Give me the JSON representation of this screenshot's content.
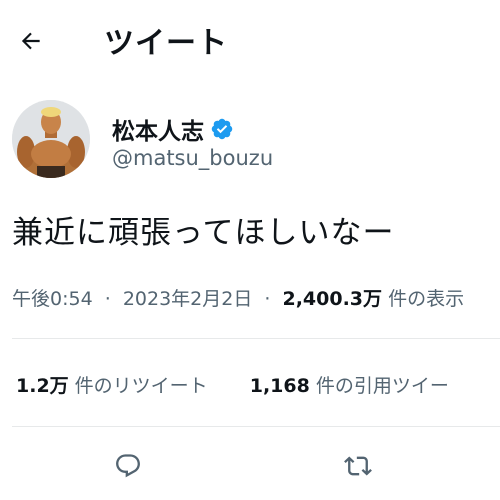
{
  "header": {
    "back_icon": "arrow-left-icon",
    "title": "ツイート"
  },
  "author": {
    "display_name": "松本人志",
    "handle": "@matsu_bouzu",
    "verified_icon": "verified-badge-icon",
    "verified_color": "#1d9bf0"
  },
  "tweet": {
    "text": "兼近に頑張ってほしいなー"
  },
  "meta": {
    "time": "午後0:54",
    "separator": "·",
    "date": "2023年2月2日",
    "views_count": "2,400.3万",
    "views_label": "件の表示"
  },
  "stats": {
    "retweets_count": "1.2万",
    "retweets_label": "件のリツイート",
    "quotes_count": "1,168",
    "quotes_label": "件の引用ツイー"
  },
  "actions": {
    "reply_icon": "reply-bubble-icon",
    "retweet_icon": "retweet-icon"
  }
}
